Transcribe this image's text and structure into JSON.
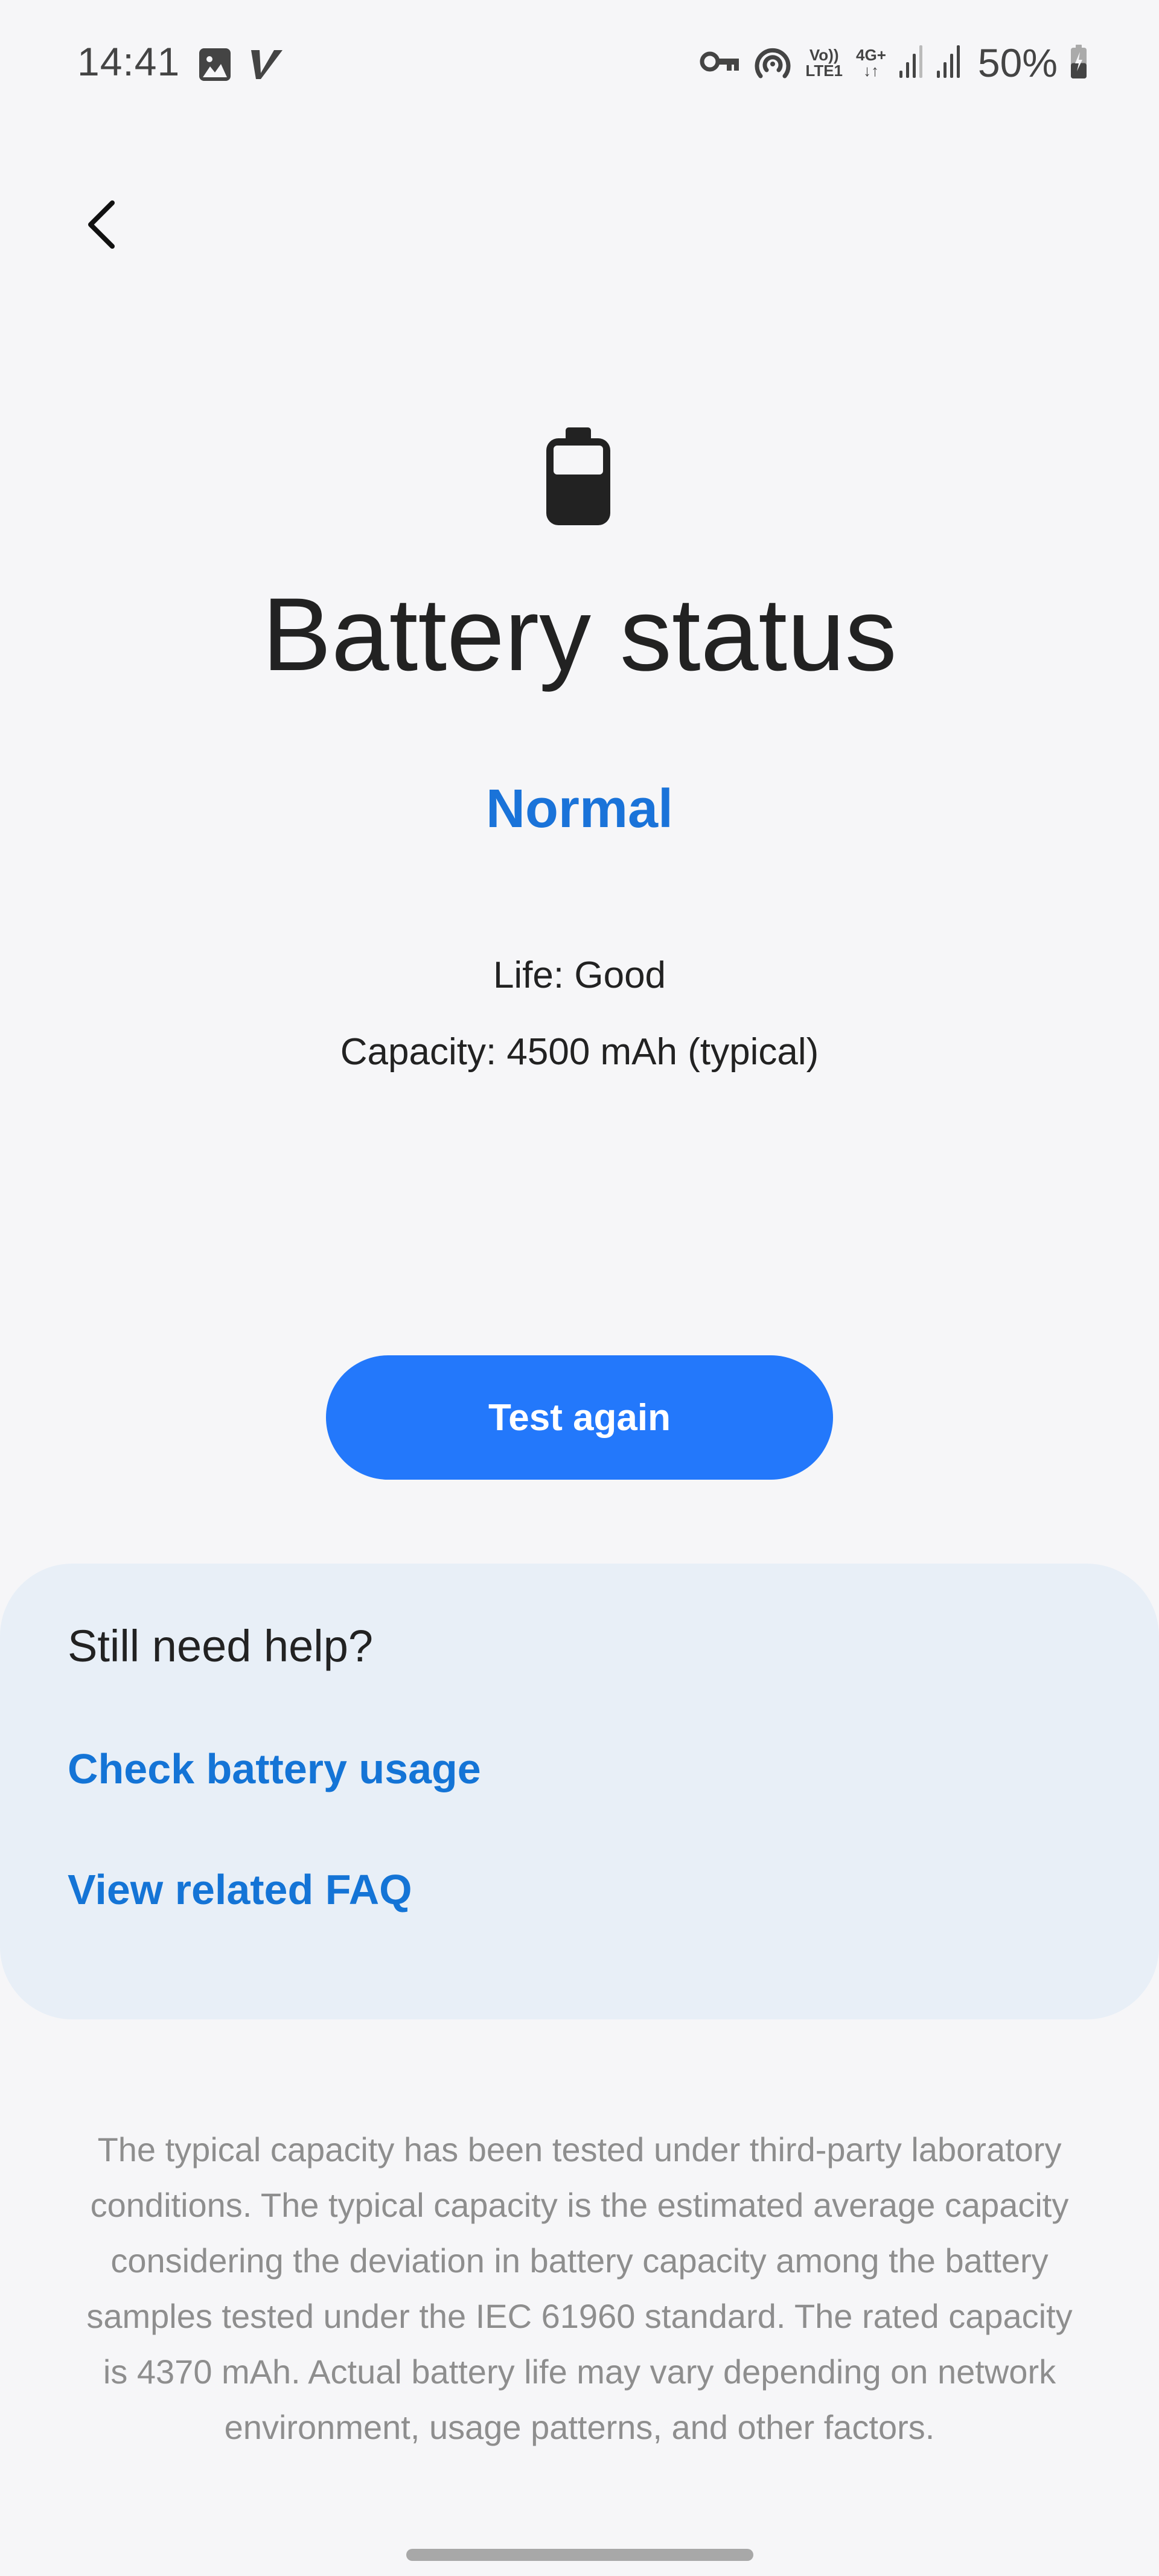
{
  "status_bar": {
    "time": "14:41",
    "left_icons": [
      "gallery-notification-icon",
      "v-app-notification-icon"
    ],
    "right_icons": [
      "vpn-key-icon",
      "hotspot-icon",
      "volte-icon",
      "data-4g-plus-icon",
      "signal-sim1-icon",
      "signal-sim2-icon"
    ],
    "volte_top": "Vo))",
    "volte_bottom": "LTE1",
    "network_top": "4G+",
    "network_bottom": "↓↑",
    "battery_percent": "50%",
    "battery_level": 0.5,
    "charging": true
  },
  "nav": {
    "back_icon": "chevron-left-icon"
  },
  "hero": {
    "icon": "battery-icon",
    "battery_fill": 0.6,
    "title": "Battery status",
    "status": "Normal",
    "life": "Life: Good",
    "capacity": "Capacity: 4500 mAh (typical)"
  },
  "actions": {
    "test_again_label": "Test again"
  },
  "help": {
    "title": "Still need help?",
    "links": [
      {
        "label": "Check battery usage"
      },
      {
        "label": "View related FAQ"
      }
    ]
  },
  "disclaimer": "The typical capacity has been tested under third-party laboratory conditions. The typical capacity is the estimated average capacity considering the deviation in battery capacity among the battery samples tested under the IEC 61960 standard. The rated capacity is 4370 mAh. Actual battery life may vary depending on network environment, usage patterns, and other factors.",
  "colors": {
    "accent": "#1a73d9",
    "button": "#2378fb",
    "card_bg": "#e8eff7",
    "page_bg": "#f6f6f8",
    "muted_text": "#8e8e8e"
  }
}
